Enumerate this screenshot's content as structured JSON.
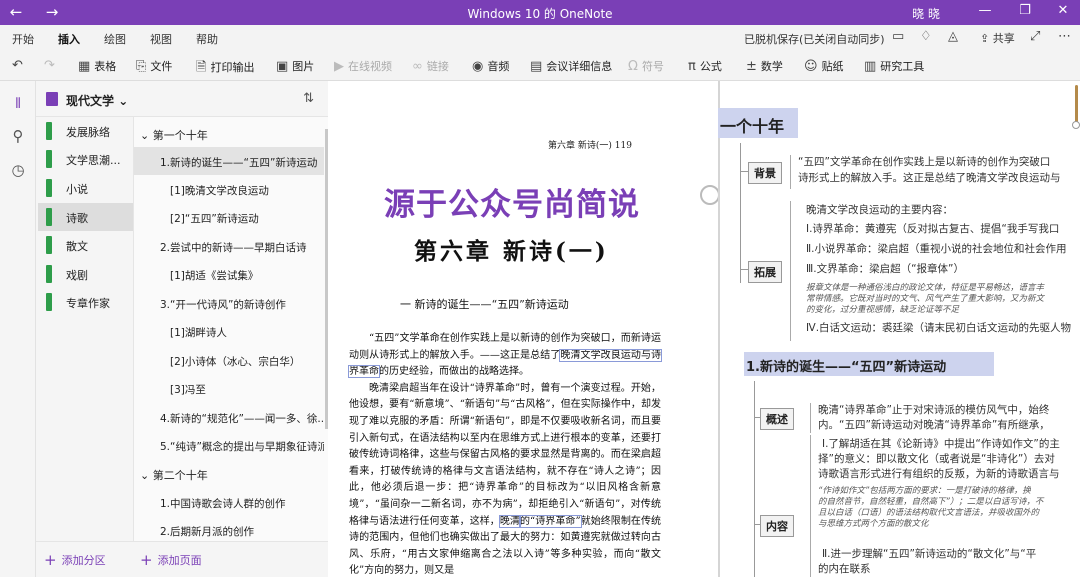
{
  "titlebar": {
    "title": "Windows 10 的 OneNote",
    "user": "晓 晓",
    "back_glyph": "←",
    "forward_glyph": "→",
    "min_glyph": "—",
    "restore_glyph": "❐",
    "close_glyph": "✕",
    "bg": "#7a3fb6"
  },
  "menu": {
    "tabs": [
      "开始",
      "插入",
      "绘图",
      "视图",
      "帮助"
    ],
    "active_tab": "插入",
    "sync_status": "已脱机保存(已关闭自动同步)",
    "share_label": "共享"
  },
  "ribbon": {
    "undo_glyph": "↶",
    "redo_glyph": "↷",
    "buttons": [
      {
        "label": "表格",
        "icon": "table-icon",
        "glyph": "▦",
        "enabled": true
      },
      {
        "label": "文件",
        "icon": "paperclip-icon",
        "glyph": "⎘",
        "enabled": true
      },
      {
        "label": "打印输出",
        "icon": "printout-icon",
        "glyph": "🗎",
        "enabled": true
      },
      {
        "label": "图片",
        "icon": "picture-icon",
        "glyph": "▣",
        "enabled": true
      },
      {
        "label": "在线视频",
        "icon": "video-icon",
        "glyph": "▶",
        "enabled": false
      },
      {
        "label": "链接",
        "icon": "link-icon",
        "glyph": "∞",
        "enabled": false
      },
      {
        "label": "音频",
        "icon": "audio-icon",
        "glyph": "◉",
        "enabled": true
      },
      {
        "label": "会议详细信息",
        "icon": "calendar-icon",
        "glyph": "▤",
        "enabled": true
      },
      {
        "label": "符号",
        "icon": "omega-icon",
        "glyph": "Ω",
        "enabled": false
      },
      {
        "label": "公式",
        "icon": "pi-icon",
        "glyph": "π",
        "enabled": true
      },
      {
        "label": "数学",
        "icon": "math-icon",
        "glyph": "±",
        "enabled": true
      },
      {
        "label": "贴纸",
        "icon": "sticker-icon",
        "glyph": "☺",
        "enabled": true
      },
      {
        "label": "研究工具",
        "icon": "research-icon",
        "glyph": "▥",
        "enabled": true
      }
    ]
  },
  "notebook": {
    "name": "现代文学",
    "chevron": "⌄",
    "sort_glyph": "⇅"
  },
  "sections": [
    {
      "label": "发展脉络",
      "active": false
    },
    {
      "label": "文学思潮...",
      "active": false
    },
    {
      "label": "小说",
      "active": false
    },
    {
      "label": "诗歌",
      "active": true
    },
    {
      "label": "散文",
      "active": false
    },
    {
      "label": "戏剧",
      "active": false
    },
    {
      "label": "专章作家",
      "active": false
    }
  ],
  "pages": [
    {
      "label": "⌄  第一个十年",
      "level": 0,
      "active": false
    },
    {
      "label": "1.新诗的诞生——“五四”新诗运动",
      "level": 1,
      "active": true
    },
    {
      "label": "[1]晚清文学改良运动",
      "level": 2,
      "active": false
    },
    {
      "label": "[2]“五四”新诗运动",
      "level": 2,
      "active": false
    },
    {
      "label": "2.尝试中的新诗——早期白话诗",
      "level": 1,
      "active": false
    },
    {
      "label": "[1]胡适《尝试集》",
      "level": 2,
      "active": false
    },
    {
      "label": "3.“开一代诗风”的新诗创作",
      "level": 1,
      "active": false
    },
    {
      "label": "[1]湖畔诗人",
      "level": 2,
      "active": false
    },
    {
      "label": "[2]小诗体（冰心、宗白华）",
      "level": 2,
      "active": false
    },
    {
      "label": "[3]冯至",
      "level": 2,
      "active": false
    },
    {
      "label": "4.新诗的“规范化”——闻一多、徐...",
      "level": 1,
      "active": false
    },
    {
      "label": "5.“纯诗”概念的提出与早期象征诗派",
      "level": 1,
      "active": false
    },
    {
      "label": "⌄  第二个十年",
      "level": 0,
      "active": false
    },
    {
      "label": "1.中国诗歌会诗人群的创作",
      "level": 1,
      "active": false
    },
    {
      "label": "2.后期新月派的创作",
      "level": 1,
      "active": false
    }
  ],
  "bottom": {
    "add_section": "添加分区",
    "add_page": "添加页面"
  },
  "book": {
    "running_head": "第六章   新诗(一)   119",
    "watermark": "源于公众号尚简说",
    "chapter": "第六章  新诗(一)",
    "section": "一   新诗的诞生——“五四”新诗运动",
    "p1a": "“五四”文学革命在创作实践上是以新诗的创作为突破口，而新诗运动则从诗形式上的解放入手。——这正是总结了",
    "p1hl": "晚清文学改良运动与诗界革命",
    "p1b": "的历史经验，而做出的战略选择。",
    "p2a": "晚清梁启超当年在设计“诗界革命”时，曾有一个演变过程。开始，他设想，要有“新意境”、“新语句”与“古风格”，但在实际操作中，却发现了难以克服的矛盾：所谓“新语句”，即是不仅要吸收新名词，而且要引入新句式，在语法结构以至内在思维方式上进行根本的变革，还要打破传统诗词格律，这些与保留古风格的要求显然是背离的。而在梁启超看来，打破传统诗的格律与文言语法结构，就不存在“诗人之诗”；因此，他必须后退一步：把“诗界革命”的目标改为“以旧风格含新意境”，“虽间杂一二新名词，亦不为病”，却拒绝引入“新语句”，对传统格律与语法进行任何变革",
    "p2hl1": "晚清",
    "p2b": "，这样，",
    "p2hl2": "的“诗界革命”",
    "p2c": "就始终限制在传统诗的范围内，但他们也确实做出了最大的努力：如黄遵宪就做过转向古风、乐府，“用古文家伸缩离合之法以入诗”等多种实验，而向“散文化”方向的努力，则又是"
  },
  "mindmap": {
    "title": "一个十年",
    "bg_node": "背景",
    "bg_text1": "“五四”文学革命在创作实践上是以新诗的创作为突破口",
    "bg_text2": "诗形式上的解放入手。这正是总结了晚清文学改良运动与",
    "ext_node": "拓展",
    "ext_head": "晚清文学改良运动的主要内容：",
    "ext_1": "Ⅰ.诗界革命：黄遵宪（反对拟古复古、提倡“我手写我口",
    "ext_2": "Ⅱ.小说界革命：梁启超（重视小说的社会地位和社会作用",
    "ext_3": "Ⅲ.文界革命：梁启超（“报章体”）",
    "ext_note1": "报章文体是一种通俗浅白的政论文体，特征是平易畅达，语言丰",
    "ext_note2": "常带情感。它既对当时的文气、风气产生了重大影响，又为新文",
    "ext_note3": "的变化，过分重视感情，缺乏论证等不足",
    "ext_4": "Ⅳ.白话文运动：裘廷梁（请末民初白话文运动的先驱人物",
    "h2": "1.新诗的诞生——“五四”新诗运动",
    "ov_node": "概述",
    "ov_text1": "晚清“诗界革命”止于对宋诗派的模仿风气中，始终",
    "ov_text2": "内。“五四”新诗运动对晚清“诗界革命”有所继承，",
    "ct_node": "内容",
    "ct_1": "Ⅰ.了解胡适在其《论新诗》中提出“作诗如作文”的主",
    "ct_2": "择”的意义：即以散文化（或者说是“非诗化”）去对",
    "ct_3": "诗歌语言形式进行有组织的反叛，为新的诗歌语言与",
    "ct_note1": "“作诗如作文”包括两方面的要求：一是打破诗的格律，换",
    "ct_note2": "的自然音节，自然轻重，自然高下”）；二是以白话写诗，不",
    "ct_note3": "且以白话（口语）的语法结构取代文言语法，并吸收国外的",
    "ct_note4": "与思维方式两个方面的散文化",
    "ct_5": "Ⅱ.进一步理解“五四”新诗运动的“散文化”与“平",
    "ct_6": "的内在联系"
  }
}
